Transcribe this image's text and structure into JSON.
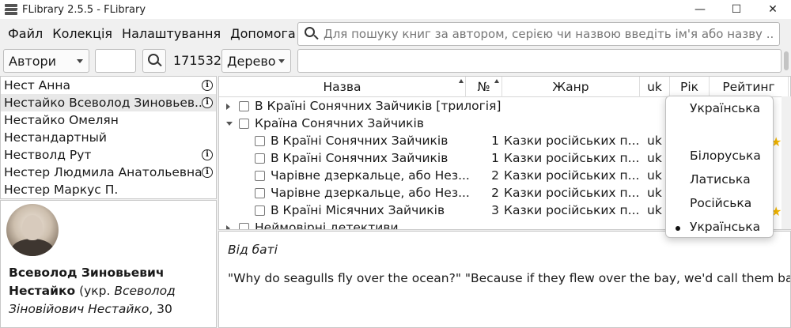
{
  "window": {
    "title": "FLibrary 2.5.5 - FLibrary",
    "minimize": "—",
    "maximize": "☐",
    "close": "✕"
  },
  "menu": [
    "Файл",
    "Колекція",
    "Налаштування",
    "Допомога"
  ],
  "search": {
    "placeholder": "Для пошуку книг за автором, серією чи назвою введіть ім'я або назву ..."
  },
  "toolbar": {
    "navigation_mode": "Автори",
    "count": "171532",
    "view_mode": "Дерево"
  },
  "authors": [
    {
      "name": "Нест Анна",
      "info": true
    },
    {
      "name": "Нестайко Всеволод Зиновьевич",
      "display": "Нестайко Всеволод Зиновьев...",
      "info": true,
      "selected": true
    },
    {
      "name": "Нестайко Омелян",
      "info": false
    },
    {
      "name": "Нестандартный",
      "info": false
    },
    {
      "name": "Нестволд Рут",
      "info": true
    },
    {
      "name": "Нестер Людмила Анатольевна",
      "info": true
    },
    {
      "name": "Нестер Маркус П.",
      "info": false
    }
  ],
  "author_info": {
    "name_bold": "Всеволод Зиновьевич Нестайко",
    "paren_prefix": " (укр. ",
    "name_italic": "Всеволод Зіновійович Нестайко",
    "tail": ", 30"
  },
  "books": {
    "columns": [
      "Назва",
      "№",
      "Жанр",
      "uk",
      "Рік",
      "Рейтинг"
    ],
    "rows": [
      {
        "level": 0,
        "expander": "collapsed",
        "title": "В Країні Сонячних Зайчиків [трилогія]",
        "num": "",
        "genre": "",
        "lang": "",
        "star": false
      },
      {
        "level": 0,
        "expander": "expanded",
        "title": "Країна Сонячних Зайчиків",
        "num": "",
        "genre": "",
        "lang": "",
        "star": false
      },
      {
        "level": 1,
        "expander": "",
        "title": "В Країні Сонячних Зайчиків",
        "num": "1",
        "genre": "Казки російських п...",
        "lang": "uk",
        "star": true
      },
      {
        "level": 1,
        "expander": "",
        "title": "В Країні Сонячних Зайчиків",
        "num": "1",
        "genre": "Казки російських п...",
        "lang": "uk",
        "star": false
      },
      {
        "level": 1,
        "expander": "",
        "title": "Чарівне дзеркальце, або Нез...",
        "num": "2",
        "genre": "Казки російських п...",
        "lang": "uk",
        "star": false
      },
      {
        "level": 1,
        "expander": "",
        "title": "Чарівне дзеркальце, або Нез...",
        "num": "2",
        "genre": "Казки російських п...",
        "lang": "uk",
        "star": false
      },
      {
        "level": 1,
        "expander": "",
        "title": "В Країні Місячних Зайчиків",
        "num": "3",
        "genre": "Казки російських п...",
        "lang": "uk",
        "star": true
      },
      {
        "level": 0,
        "expander": "collapsed",
        "title": "Неймовірні детективи",
        "num": "",
        "genre": "",
        "lang": "",
        "star": false
      }
    ]
  },
  "annotation": {
    "title": "Від баті",
    "text": "\"Why do seagulls fly over the ocean?\" \"Because if they flew over the bay, we'd call them bagels.\""
  },
  "language_popup": {
    "options": [
      {
        "label": "Українська",
        "selected": false
      },
      {
        "label": "",
        "selected": false
      },
      {
        "label": "Білоруська",
        "selected": false
      },
      {
        "label": "Латиська",
        "selected": false
      },
      {
        "label": "Російська",
        "selected": false
      },
      {
        "label": "Українська",
        "selected": true
      }
    ]
  },
  "colors": {
    "star": "#f2b500",
    "selected_row": "#e8e8e8",
    "panel_border": "#c8c8c8"
  }
}
